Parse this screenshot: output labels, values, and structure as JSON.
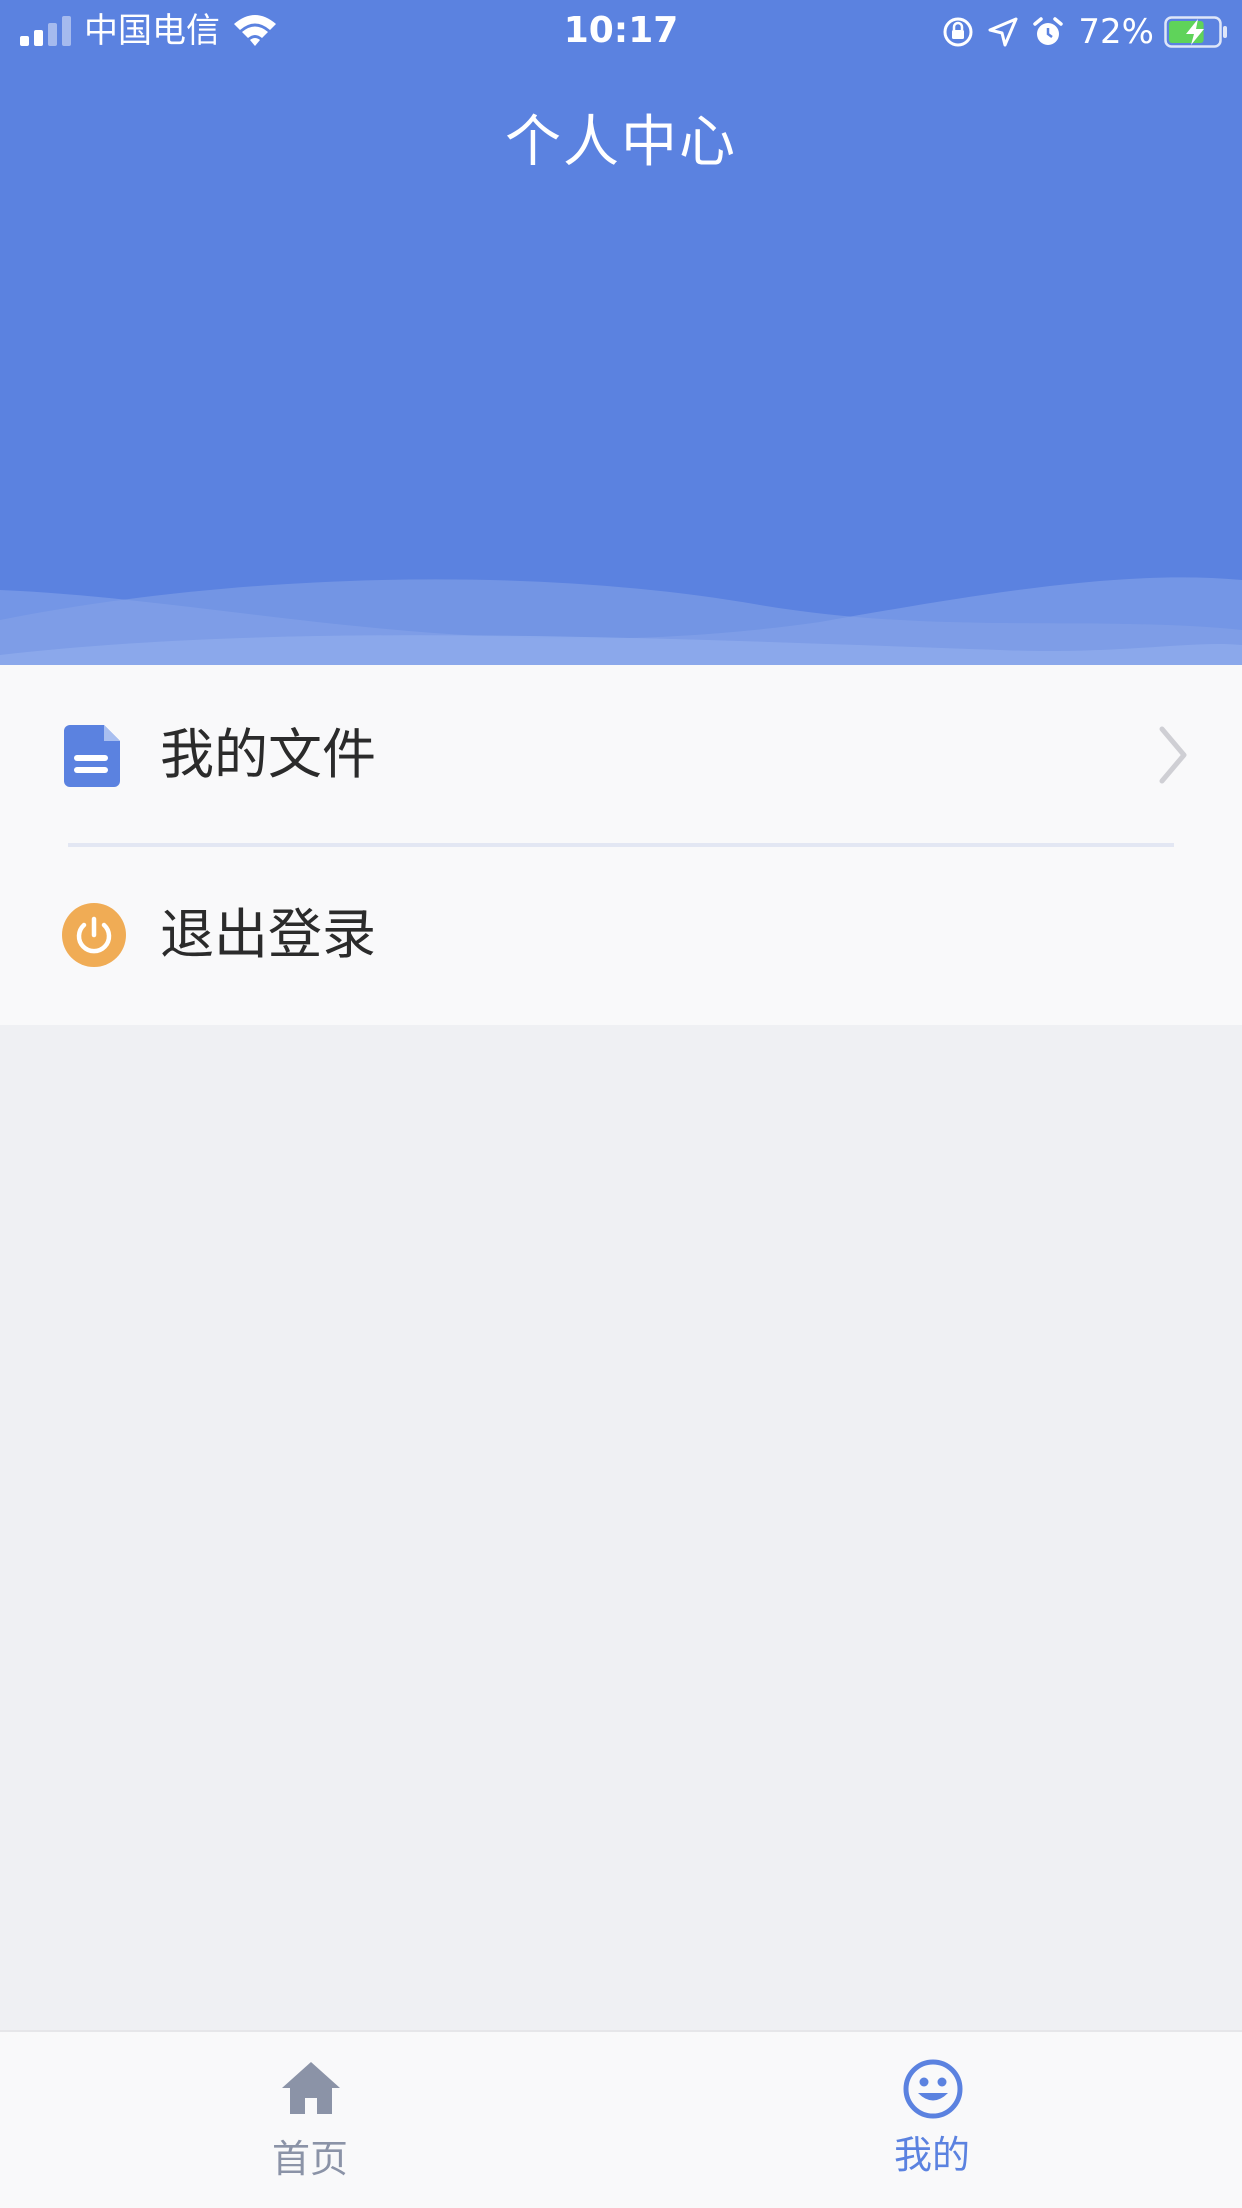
{
  "status_bar": {
    "carrier": "中国电信",
    "time": "10:17",
    "battery_percent": "72%",
    "battery_level": 0.72
  },
  "header": {
    "title": "个人中心"
  },
  "menu": {
    "items": [
      {
        "label": "我的文件",
        "icon": "document-icon",
        "has_chevron": true
      },
      {
        "label": "退出登录",
        "icon": "power-icon",
        "has_chevron": false
      }
    ]
  },
  "tabbar": {
    "tabs": [
      {
        "label": "首页",
        "icon": "home-icon",
        "active": false
      },
      {
        "label": "我的",
        "icon": "smiley-icon",
        "active": true
      }
    ]
  },
  "colors": {
    "header_blue": "#5b82e0",
    "active_tab": "#5b82e0",
    "inactive_tab": "#8b93a7",
    "power_orange": "#f0ac55",
    "background": "#eff0f3"
  }
}
